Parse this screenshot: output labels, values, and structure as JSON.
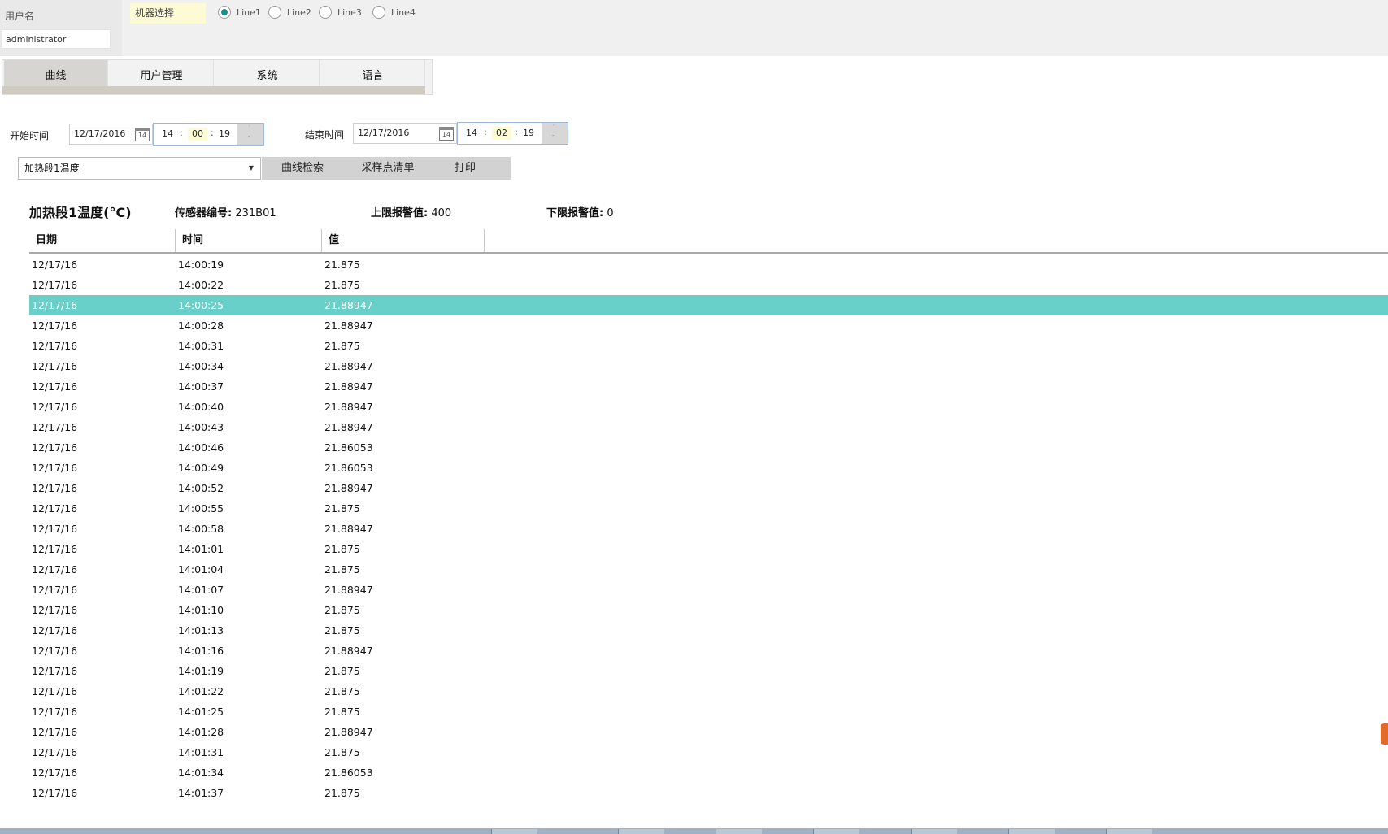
{
  "header": {
    "username_label": "用户名",
    "username_value": "administrator",
    "machine_label": "机器选择",
    "lines": [
      {
        "label": "Line1",
        "selected": true
      },
      {
        "label": "Line2",
        "selected": false
      },
      {
        "label": "Line3",
        "selected": false
      },
      {
        "label": "Line4",
        "selected": false
      }
    ]
  },
  "tabs": [
    "曲线",
    "用户管理",
    "系统",
    "语言"
  ],
  "active_tab": "曲线",
  "filter": {
    "start_label": "开始时间",
    "start_date": "12/17/2016",
    "start_time": {
      "h": "14",
      "m": "00",
      "s": "19"
    },
    "end_label": "结束时间",
    "end_date": "12/17/2016",
    "end_time": {
      "h": "14",
      "m": "02",
      "s": "19"
    },
    "calendar_day": "14",
    "sensor_select": "加热段1温度",
    "buttons": [
      "曲线检索",
      "采样点清单",
      "打印"
    ]
  },
  "sensor": {
    "title": "加热段1温度(°C)",
    "id_label": "传感器编号:",
    "id_value": "231B01",
    "upper_label": "上限报警值:",
    "upper_value": "400",
    "lower_label": "下限报警值:",
    "lower_value": "0"
  },
  "table": {
    "columns": [
      "日期",
      "时间",
      "值"
    ],
    "selected_index": 2,
    "rows": [
      [
        "12/17/16",
        "14:00:19",
        "21.875"
      ],
      [
        "12/17/16",
        "14:00:22",
        "21.875"
      ],
      [
        "12/17/16",
        "14:00:25",
        "21.88947"
      ],
      [
        "12/17/16",
        "14:00:28",
        "21.88947"
      ],
      [
        "12/17/16",
        "14:00:31",
        "21.875"
      ],
      [
        "12/17/16",
        "14:00:34",
        "21.88947"
      ],
      [
        "12/17/16",
        "14:00:37",
        "21.88947"
      ],
      [
        "12/17/16",
        "14:00:40",
        "21.88947"
      ],
      [
        "12/17/16",
        "14:00:43",
        "21.88947"
      ],
      [
        "12/17/16",
        "14:00:46",
        "21.86053"
      ],
      [
        "12/17/16",
        "14:00:49",
        "21.86053"
      ],
      [
        "12/17/16",
        "14:00:52",
        "21.88947"
      ],
      [
        "12/17/16",
        "14:00:55",
        "21.875"
      ],
      [
        "12/17/16",
        "14:00:58",
        "21.88947"
      ],
      [
        "12/17/16",
        "14:01:01",
        "21.875"
      ],
      [
        "12/17/16",
        "14:01:04",
        "21.875"
      ],
      [
        "12/17/16",
        "14:01:07",
        "21.88947"
      ],
      [
        "12/17/16",
        "14:01:10",
        "21.875"
      ],
      [
        "12/17/16",
        "14:01:13",
        "21.875"
      ],
      [
        "12/17/16",
        "14:01:16",
        "21.88947"
      ],
      [
        "12/17/16",
        "14:01:19",
        "21.875"
      ],
      [
        "12/17/16",
        "14:01:22",
        "21.875"
      ],
      [
        "12/17/16",
        "14:01:25",
        "21.875"
      ],
      [
        "12/17/16",
        "14:01:28",
        "21.88947"
      ],
      [
        "12/17/16",
        "14:01:31",
        "21.875"
      ],
      [
        "12/17/16",
        "14:01:34",
        "21.86053"
      ],
      [
        "12/17/16",
        "14:01:37",
        "21.875"
      ]
    ]
  },
  "colors": {
    "selected_row": "#68d0c8",
    "radio_accent": "#1a8f8a",
    "highlight_field": "#fdfbd6"
  }
}
